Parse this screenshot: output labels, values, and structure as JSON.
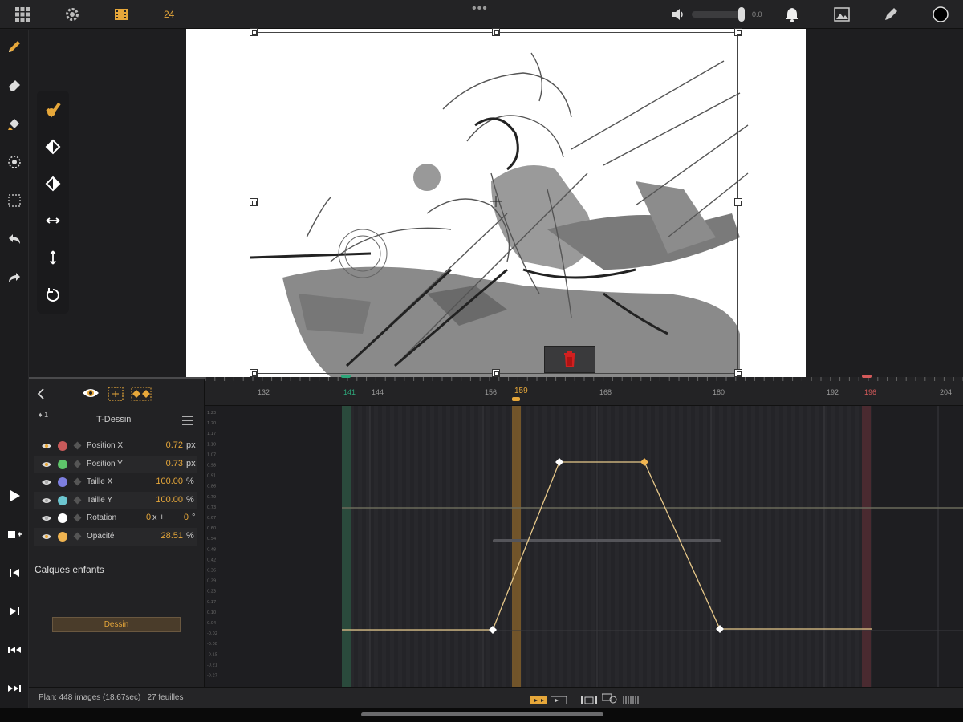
{
  "topbar": {
    "fps": "24",
    "more": "•••",
    "volume_value": "0.0",
    "volume_level": 0.95
  },
  "canvas": {
    "delete_label": "Supprimer"
  },
  "layer": {
    "keyframe_count": "1",
    "name": "T-Dessin"
  },
  "properties": [
    {
      "name": "Position X",
      "value": "0.72",
      "unit": "px",
      "color": "#c85a5a"
    },
    {
      "name": "Position Y",
      "value": "0.73",
      "unit": "px",
      "color": "#5ec46a"
    },
    {
      "name": "Taille X",
      "value": "100.00",
      "unit": "%",
      "color": "#7d7fe0"
    },
    {
      "name": "Taille Y",
      "value": "100.00",
      "unit": "%",
      "color": "#6cc6d0"
    },
    {
      "name": "Rotation",
      "value_turns": "0",
      "turns_unit": "x +",
      "value": "0",
      "unit": "°",
      "color": "#ffffff"
    },
    {
      "name": "Opacité",
      "value": "28.51",
      "unit": "%",
      "color": "#f0b450"
    }
  ],
  "children_label": "Calques enfants",
  "dessin_button": "Dessin",
  "ruler": {
    "ticks": [
      "132",
      "141",
      "144",
      "156",
      "159",
      "168",
      "180",
      "192",
      "196",
      "204"
    ],
    "current_frame": "159",
    "in_marker": "141",
    "out_marker": "196"
  },
  "graph": {
    "y_labels": [
      "1.23",
      "1.20",
      "1.17",
      "1.10",
      "1.07",
      "0.98",
      "0.91",
      "0.86",
      "0.79",
      "0.73",
      "0.67",
      "0.60",
      "0.54",
      "0.48",
      "0.42",
      "0.36",
      "0.29",
      "0.23",
      "0.17",
      "0.10",
      "0.04",
      "-0.02",
      "-0.08",
      "-0.15",
      "-0.21",
      "-0.27"
    ]
  },
  "status": {
    "text": "Plan: 448 images (18.67sec) | 27 feuilles"
  },
  "colors": {
    "accent": "#e6a73a",
    "in_marker": "#2ea67a",
    "out_marker": "#d45a5a"
  }
}
